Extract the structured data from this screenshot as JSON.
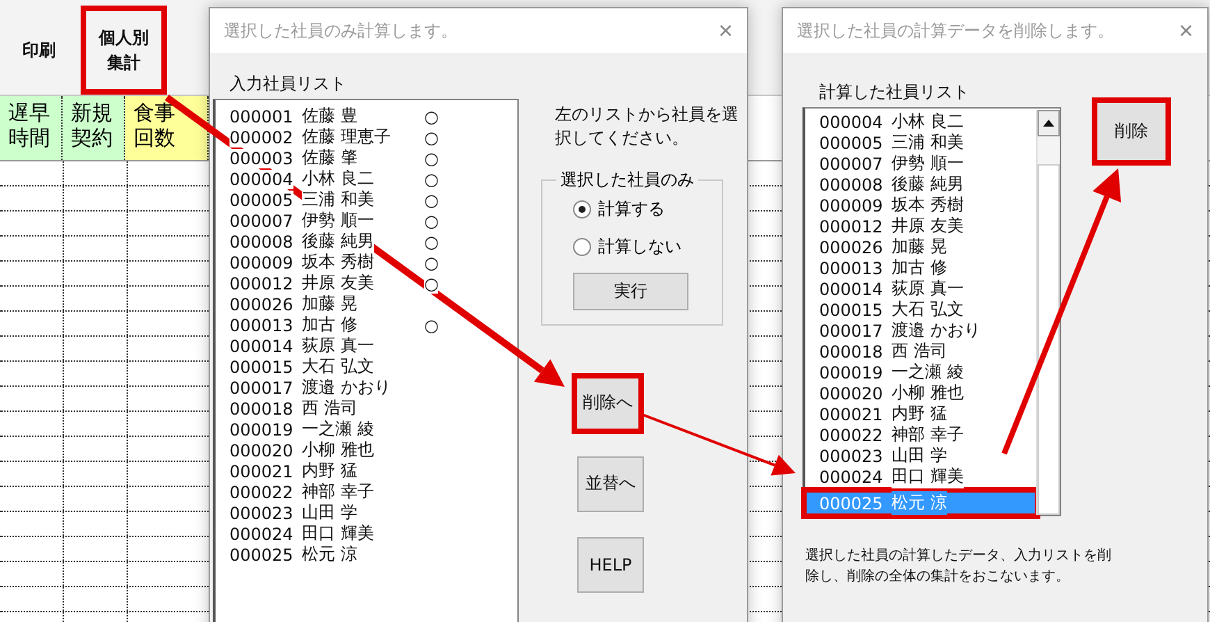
{
  "ribbon": {
    "buttons": [
      {
        "label": "印刷",
        "highlighted": false
      },
      {
        "label": "個人別集計",
        "highlighted": true
      }
    ]
  },
  "sheet": {
    "header_cells": [
      {
        "text": "遅早時間",
        "color": "#ccffcc"
      },
      {
        "text": "新規契約",
        "color": "#ccffcc"
      },
      {
        "text": "食事回数",
        "color": "#ffff99"
      }
    ]
  },
  "calc_dialog": {
    "title": "選択した社員のみ計算します。",
    "close": "×",
    "list_label": "入力社員リスト",
    "employees": [
      {
        "id": "000001",
        "name": "佐藤 豊",
        "mark": "○"
      },
      {
        "id": "000002",
        "name": "佐藤 理恵子",
        "mark": "○"
      },
      {
        "id": "000003",
        "name": "佐藤 肇",
        "mark": "○"
      },
      {
        "id": "000004",
        "name": "小林 良二",
        "mark": "○"
      },
      {
        "id": "000005",
        "name": "三浦 和美",
        "mark": "○"
      },
      {
        "id": "000007",
        "name": "伊勢 順一",
        "mark": "○"
      },
      {
        "id": "000008",
        "name": "後藤 純男",
        "mark": "○"
      },
      {
        "id": "000009",
        "name": "坂本 秀樹",
        "mark": "○"
      },
      {
        "id": "000012",
        "name": "井原 友美",
        "mark": "○"
      },
      {
        "id": "000026",
        "name": "加藤 晃"
      },
      {
        "id": "000013",
        "name": "加古 修",
        "mark": "○"
      },
      {
        "id": "000014",
        "name": "荻原 真一"
      },
      {
        "id": "000015",
        "name": "大石 弘文"
      },
      {
        "id": "000017",
        "name": "渡邉 かおり"
      },
      {
        "id": "000018",
        "name": "西 浩司"
      },
      {
        "id": "000019",
        "name": "一之瀬 綾"
      },
      {
        "id": "000020",
        "name": "小柳 雅也"
      },
      {
        "id": "000021",
        "name": "内野 猛"
      },
      {
        "id": "000022",
        "name": "神部 幸子"
      },
      {
        "id": "000023",
        "name": "山田 学"
      },
      {
        "id": "000024",
        "name": "田口 輝美"
      },
      {
        "id": "000025",
        "name": "松元 涼"
      }
    ],
    "instruction": "左のリストから社員を選択してください。",
    "group": {
      "legend": "選択した社員のみ",
      "options": [
        {
          "label": "計算する",
          "selected": true
        },
        {
          "label": "計算しない",
          "selected": false
        }
      ],
      "run_button": "実行"
    },
    "buttons": [
      {
        "label": "削除へ",
        "highlighted": true
      },
      {
        "label": "並替へ",
        "highlighted": false
      },
      {
        "label": "HELP",
        "highlighted": false
      }
    ]
  },
  "delete_dialog": {
    "title": "選択した社員の計算データを削除します。",
    "close": "×",
    "list_label": "計算した社員リスト",
    "employees": [
      {
        "id": "000004",
        "name": "小林 良二",
        "selected": false,
        "highlighted": false
      },
      {
        "id": "000005",
        "name": "三浦 和美",
        "selected": false,
        "highlighted": false
      },
      {
        "id": "000007",
        "name": "伊勢 順一",
        "selected": false,
        "highlighted": false
      },
      {
        "id": "000008",
        "name": "後藤 純男",
        "selected": false,
        "highlighted": false
      },
      {
        "id": "000009",
        "name": "坂本 秀樹",
        "selected": false,
        "highlighted": false
      },
      {
        "id": "000012",
        "name": "井原 友美",
        "selected": false,
        "highlighted": false
      },
      {
        "id": "000026",
        "name": "加藤 晃",
        "selected": false,
        "highlighted": false
      },
      {
        "id": "000013",
        "name": "加古 修",
        "selected": false,
        "highlighted": false
      },
      {
        "id": "000014",
        "name": "荻原 真一",
        "selected": false,
        "highlighted": false
      },
      {
        "id": "000015",
        "name": "大石 弘文",
        "selected": false,
        "highlighted": false
      },
      {
        "id": "000017",
        "name": "渡邉 かおり",
        "selected": false,
        "highlighted": false
      },
      {
        "id": "000018",
        "name": "西 浩司",
        "selected": false,
        "highlighted": false
      },
      {
        "id": "000019",
        "name": "一之瀬 綾",
        "selected": false,
        "highlighted": false
      },
      {
        "id": "000020",
        "name": "小柳 雅也",
        "selected": false,
        "highlighted": false
      },
      {
        "id": "000021",
        "name": "内野 猛",
        "selected": false,
        "highlighted": false
      },
      {
        "id": "000022",
        "name": "神部 幸子",
        "selected": false,
        "highlighted": false
      },
      {
        "id": "000023",
        "name": "山田 学",
        "selected": false,
        "highlighted": false
      },
      {
        "id": "000024",
        "name": "田口 輝美",
        "selected": false,
        "highlighted": false
      },
      {
        "id": "000025",
        "name": "松元 涼",
        "selected": true,
        "highlighted": true
      }
    ],
    "delete_button": {
      "label": "削除",
      "highlighted": true
    },
    "description": "選択した社員の計算したデータ、入力リストを削除し、削除の全体の集計をおこないます。"
  }
}
